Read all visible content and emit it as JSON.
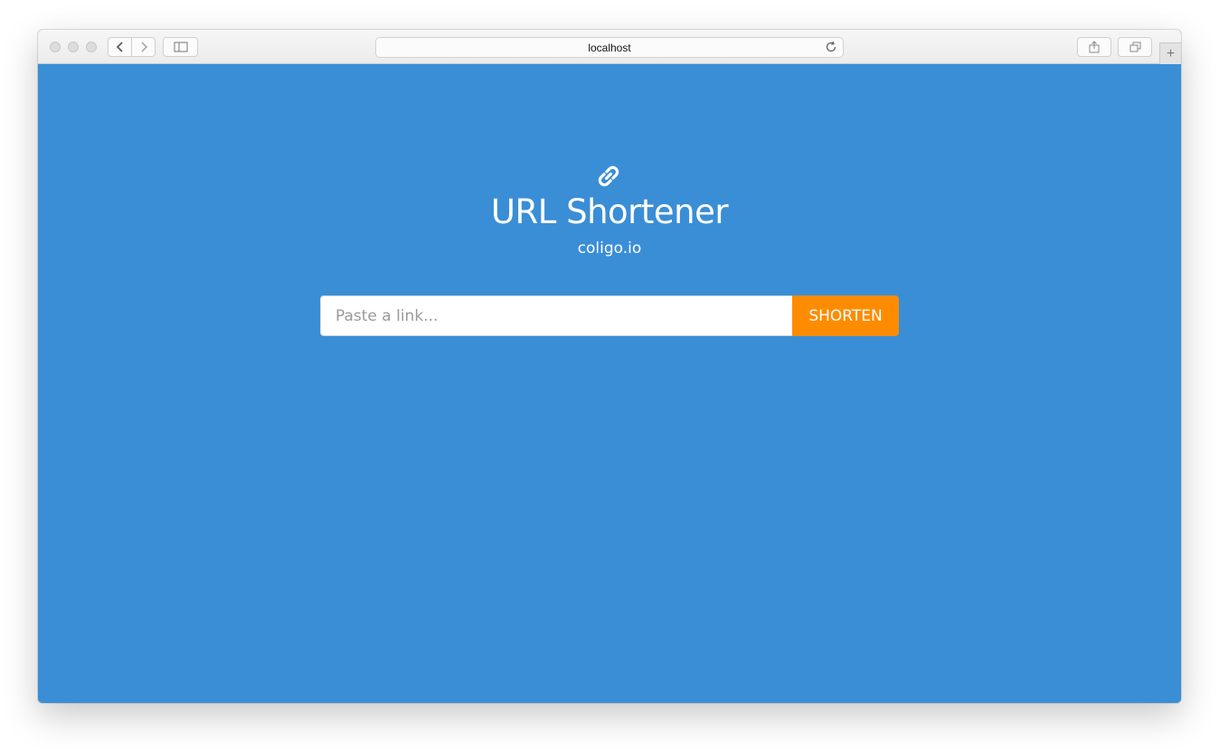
{
  "browser": {
    "address": "localhost",
    "new_tab_symbol": "+",
    "icons": {
      "back": "chevron-left-icon",
      "forward": "chevron-right-icon",
      "sidebar": "sidebar-icon",
      "reload": "reload-icon",
      "share": "share-icon",
      "tabs": "tabs-overview-icon"
    }
  },
  "page": {
    "logo_icon": "link-icon",
    "title": "URL Shortener",
    "subtitle": "coligo.io",
    "input_placeholder": "Paste a link...",
    "input_value": "",
    "button_label": "SHORTEN"
  },
  "colors": {
    "background": "#3a8ed6",
    "button": "#ff8c00",
    "text": "#ffffff"
  }
}
